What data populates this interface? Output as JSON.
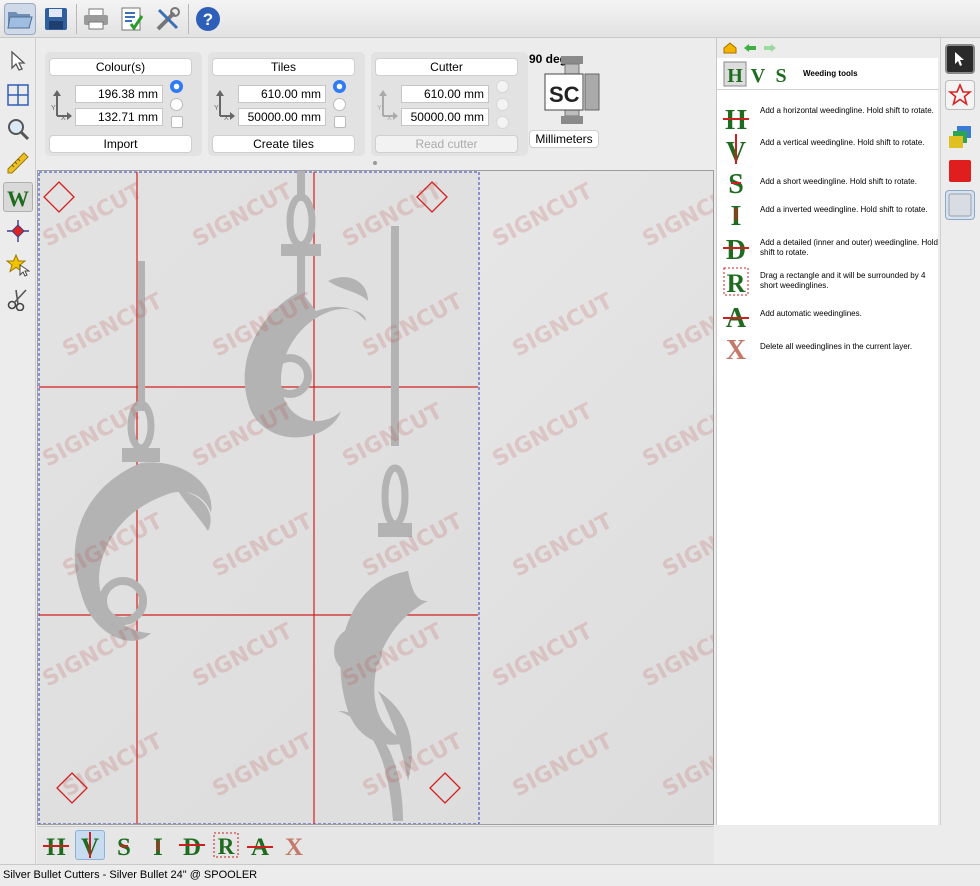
{
  "toolbar": {
    "icons": [
      "open-folder-icon",
      "save-disk-icon",
      "printer-icon",
      "checklist-icon",
      "tools-icon",
      "help-icon"
    ]
  },
  "left_tools": [
    "pointer-icon",
    "grid-icon",
    "zoom-icon",
    "ruler-pencil-icon",
    "weeding-icon",
    "crosshair-icon",
    "star-select-icon",
    "scissors-icon"
  ],
  "colours_panel": {
    "title": "Colour(s)",
    "x_value": "196.38 mm",
    "y_value": "132.71 mm",
    "button": "Import"
  },
  "tiles_panel": {
    "title": "Tiles",
    "x_value": "610.00 mm",
    "y_value": "50000.00 mm",
    "button": "Create tiles"
  },
  "cutter_panel": {
    "title": "Cutter",
    "x_value": "610.00 mm",
    "y_value": "50000.00 mm",
    "button": "Read cutter"
  },
  "cutter_status": {
    "rotation": "90 deg",
    "unit_button": "Millimeters",
    "logo": "SC"
  },
  "right_panel": {
    "title": "Weeding tools",
    "tools": [
      {
        "letter": "H",
        "text": "Add a horizontal weedingline. Hold shift to rotate."
      },
      {
        "letter": "V",
        "text": "Add a vertical weedingline. Hold shift to rotate."
      },
      {
        "letter": "S",
        "text": "Add a short weedingline. Hold shift to rotate."
      },
      {
        "letter": "I",
        "text": "Add a inverted weedingline. Hold shift to rotate."
      },
      {
        "letter": "D",
        "text": "Add a detailed (inner and outer) weedingline. Hold shift to rotate."
      },
      {
        "letter": "R",
        "text": "Drag a rectangle and it will be surrounded by 4 short weedinglines."
      },
      {
        "letter": "A",
        "text": "Add automatic weedinglines."
      },
      {
        "letter": "X",
        "text": "Delete all weedinglines in the current layer."
      }
    ]
  },
  "bottom_bar": {
    "letters": [
      "H",
      "V",
      "S",
      "I",
      "D",
      "R",
      "A",
      "X"
    ],
    "active": "V"
  },
  "watermark": "SIGNCUT",
  "status": "Silver Bullet Cutters - Silver Bullet 24\" @ SPOOLER",
  "colors": {
    "weed_green": "#1f6b1f",
    "weed_red": "#cc1f1f",
    "tile_line": "#d22020",
    "bound_dash": "#2f3fbf",
    "accent_blue": "#2f7bf5"
  }
}
